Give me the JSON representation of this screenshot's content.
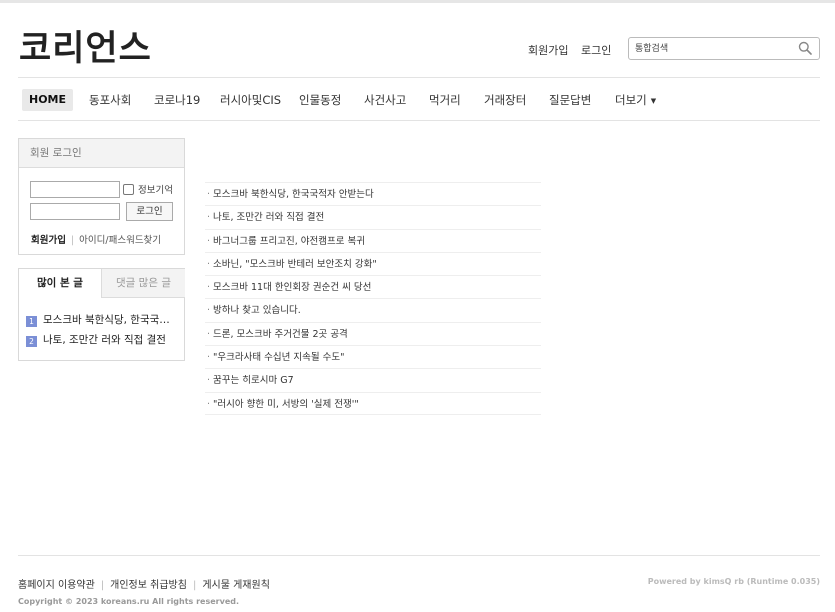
{
  "site": {
    "logo": "코리언스"
  },
  "util": {
    "signup": "회원가입",
    "login": "로그인"
  },
  "search": {
    "placeholder": "통합검색"
  },
  "nav": {
    "items": [
      "HOME",
      "동포사회",
      "코로나19",
      "러시아및CIS",
      "인물동정",
      "사건사고",
      "먹거리",
      "거래장터",
      "질문답변",
      "더보기"
    ],
    "more_caret": "▼"
  },
  "login_box": {
    "title": "회원 로그인",
    "remember": "정보기억",
    "button": "로그인",
    "signup_link": "회원가입",
    "separator": "|",
    "find_link": "아이디/패스워드찾기"
  },
  "popular": {
    "tabs": [
      "많이 본 글",
      "댓글 많은 글"
    ],
    "items": [
      {
        "rank": "1",
        "title": "모스크바 북한식당, 한국국적자 안받는다"
      },
      {
        "rank": "2",
        "title": "나토, 조만간 러와 직접 결전"
      }
    ]
  },
  "news": {
    "bullet": "·",
    "items": [
      "모스크바 북한식당, 한국국적자 안받는다",
      "나토, 조만간 러와 직접 결전",
      "바그너그룹 프리고진, 야전캠프로 복귀",
      "소바닌, \"모스크바 반테러 보안조치 강화\"",
      "모스크바 11대 한인회장 권순건 씨 당선",
      "방하나 찾고 있습니다.",
      "드론, 모스크바 주거건물 2곳 공격",
      "\"우크라사태 수십년 지속될 수도\"",
      "꿈꾸는 히로시마 G7",
      "\"러시아 향한 미, 서방의 '실제 전쟁'\""
    ]
  },
  "footer": {
    "links": [
      "홈페이지 이용약관",
      "개인정보 취급방침",
      "게시물 게재원칙"
    ],
    "separator": "|",
    "copyright": "Copyright © 2023 koreans.ru All rights reserved.",
    "powered": "Powered by kimsQ rb (Runtime 0.035)"
  }
}
